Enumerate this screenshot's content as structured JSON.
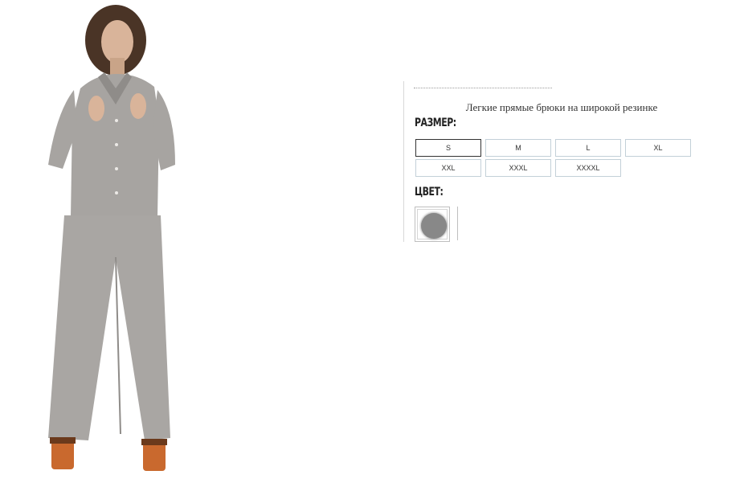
{
  "product": {
    "title": "Легкие прямые брюки на широкой резинке",
    "image_alt": "model-in-grey-linen-suit"
  },
  "size_section": {
    "label": "Размер:",
    "options": [
      "S",
      "M",
      "L",
      "XL",
      "XXL",
      "XXXL",
      "XXXXL"
    ],
    "selected": "S"
  },
  "color_section": {
    "label": "Цвет:",
    "swatches": [
      {
        "color": "#888888",
        "selected": true
      }
    ]
  },
  "colors": {
    "fabric": "#a7a4a1",
    "fabric_shadow": "#8f8c89",
    "skin": "#d9b49a",
    "hair": "#4a3426",
    "shoes": "#c9692e",
    "divider": "#d8d8d8"
  }
}
